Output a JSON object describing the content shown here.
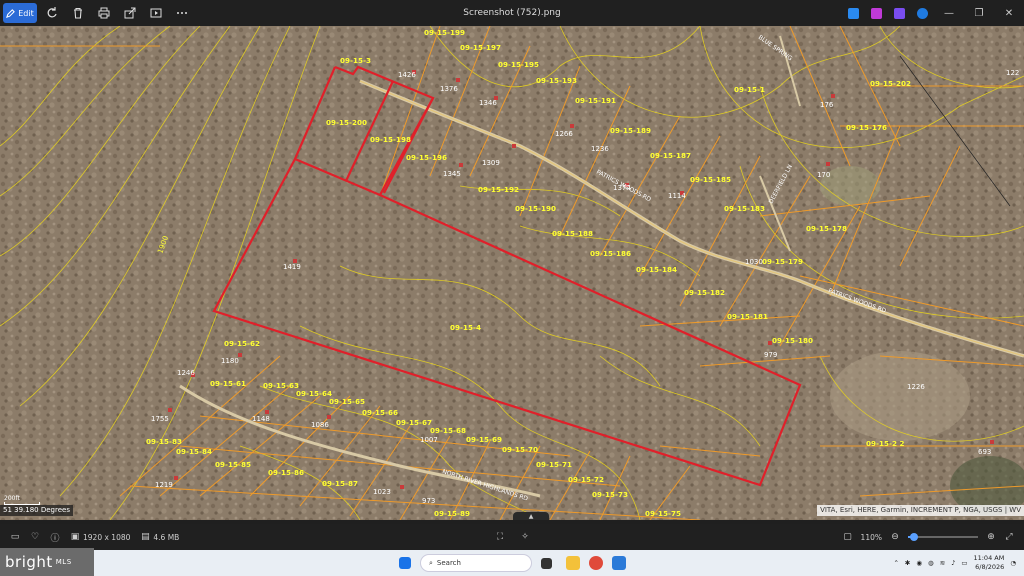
{
  "window": {
    "title": "Screenshot (752).png",
    "edit_label": "Edit",
    "controls": [
      "minimize-icon",
      "maximize-icon",
      "close-icon"
    ]
  },
  "toolbar": {
    "icons": [
      "rotate-icon",
      "delete-icon",
      "print-icon",
      "share-icon",
      "slideshow-icon",
      "more-icon"
    ]
  },
  "map": {
    "parcels": [
      "09-15-3",
      "09-15-199",
      "09-15-197",
      "09-15-195",
      "09-15-193",
      "09-15-191",
      "09-15-189",
      "09-15-187",
      "09-15-185",
      "09-15-183",
      "09-15-200",
      "09-15-198",
      "09-15-196",
      "09-15-192",
      "09-15-190",
      "09-15-188",
      "09-15-186",
      "09-15-184",
      "09-15-182",
      "09-15-181",
      "09-15-180",
      "09-15-179",
      "09-15-178",
      "09-15-176",
      "09-15-202",
      "09-15-1",
      "09-15-4",
      "09-15-62",
      "09-15-61",
      "09-15-63",
      "09-15-64",
      "09-15-65",
      "09-15-66",
      "09-15-67",
      "09-15-68",
      "09-15-69",
      "09-15-70",
      "09-15-71",
      "09-15-72",
      "09-15-73",
      "09-15-75",
      "09-15-83",
      "09-15-84",
      "09-15-85",
      "09-15-86",
      "09-15-87",
      "09-15-89",
      "09-15-2 2"
    ],
    "addresses": [
      "1426",
      "1376",
      "1346",
      "1266",
      "1236",
      "1309",
      "1345",
      "1374",
      "1114",
      "1419",
      "176",
      "170",
      "1030",
      "979",
      "1180",
      "1246",
      "1148",
      "1086",
      "1007",
      "1755",
      "1219",
      "1023",
      "973",
      "1226",
      "693",
      "122"
    ],
    "roads": [
      "PATRICS WOODS RD",
      "PATRICS WOODS RD",
      "NORTH RIVER HIGHLANDS RD",
      "DEERFIELD LN",
      "BLUE SPRING"
    ],
    "contour_label": "1900",
    "coordinates": "51 39.180 Degrees",
    "scale": "200ft",
    "attribution": "VITA, Esri, HERE, Garmin, INCREMENT P, NGA, USGS | WV"
  },
  "status": {
    "dimensions": "1920 x 1080",
    "filesize": "4.6 MB",
    "zoom": "110%",
    "zoom_fraction": 0.08
  },
  "taskbar": {
    "search_placeholder": "Search",
    "time": "11:04 AM",
    "date": "6/8/2026"
  },
  "watermark": {
    "brand": "bright",
    "suffix": "MLS"
  },
  "colors": {
    "boundary": "#e0202a",
    "parcel_lines": "#ee9a2a",
    "contours": "#e6d21e",
    "labels": "#ffff33",
    "accent": "#2b6bd6"
  }
}
